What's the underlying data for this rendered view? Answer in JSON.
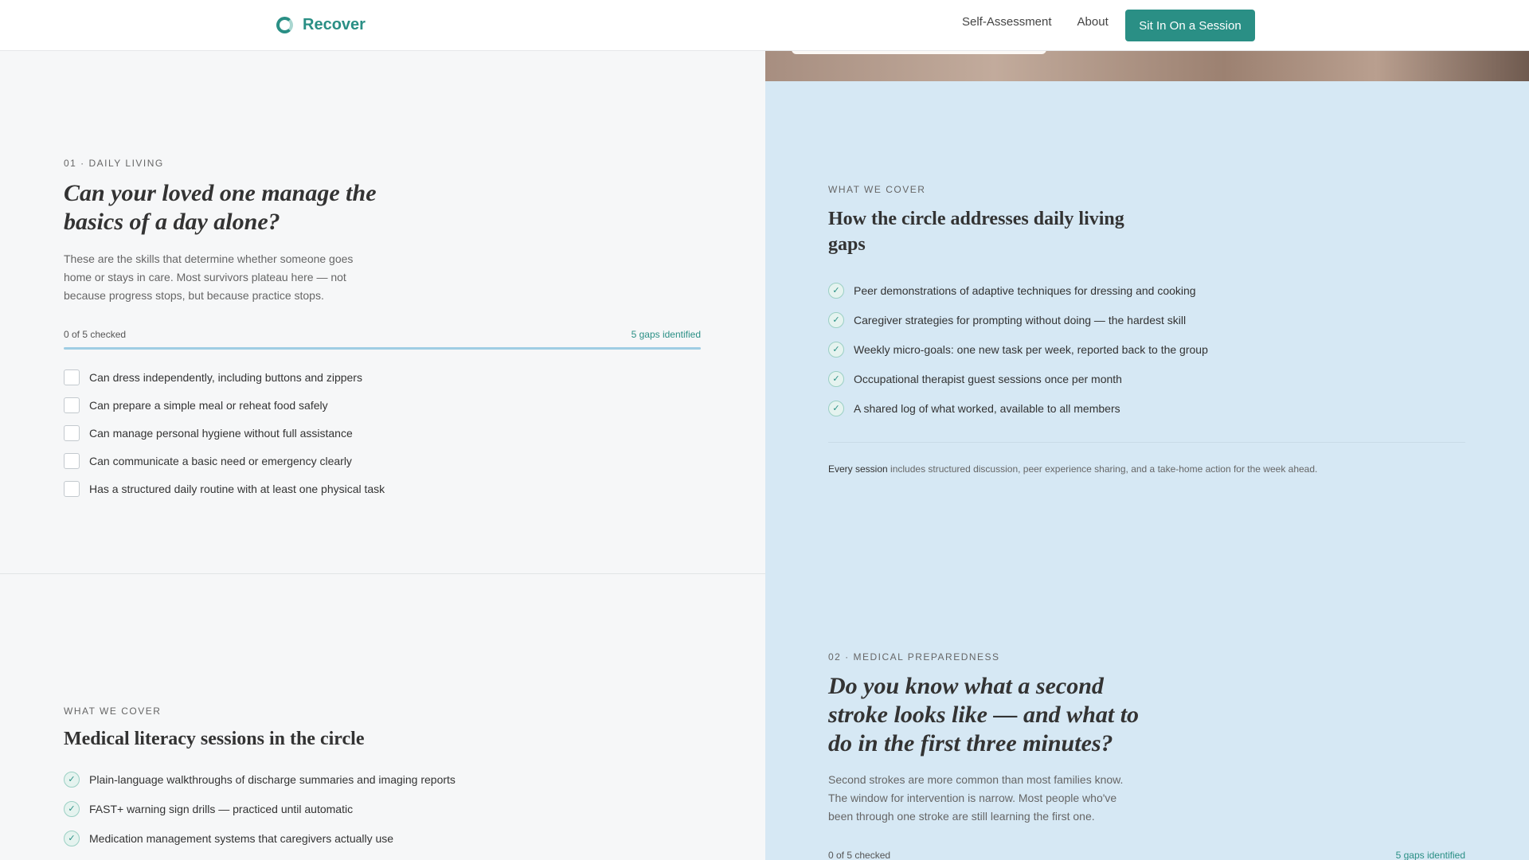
{
  "header": {
    "brand_name": "Recover",
    "nav": {
      "self_assessment": "Self-Assessment",
      "about": "About",
      "cta": "Sit In On a Session"
    }
  },
  "section1": {
    "eyebrow": "01 · DAILY LIVING",
    "title_line1": "Can your loved one manage the",
    "title_line2": "basics of a day alone?",
    "body_line1": "These are the skills that determine whether someone goes",
    "body_line2": "home or stays in care. Most survivors plateau here — not",
    "body_line3": "because progress stops, but because practice stops.",
    "checked_text": "0 of 5 checked",
    "gaps_text": "5 gaps identified",
    "checked_fraction": 0,
    "items": [
      {
        "label": "Can dress independently, including buttons and zippers",
        "checked": false
      },
      {
        "label": "Can prepare a simple meal or reheat food safely",
        "checked": false
      },
      {
        "label": "Can manage personal hygiene without full assistance",
        "checked": false
      },
      {
        "label": "Can communicate a basic need or emergency clearly",
        "checked": false
      },
      {
        "label": "Has a structured daily routine with at least one physical task",
        "checked": false
      }
    ]
  },
  "cover1": {
    "eyebrow": "WHAT WE COVER",
    "title_line1": "How the circle addresses daily living",
    "title_line2": "gaps",
    "items": [
      "Peer demonstrations of adaptive techniques for dressing and cooking",
      "Caregiver strategies for prompting without doing — the hardest skill",
      "Weekly micro-goals: one new task per week, reported back to the group",
      "Occupational therapist guest sessions once per month",
      "A shared log of what worked, available to all members"
    ],
    "footnote_strong": "Every session",
    "footnote_rest": " includes structured discussion, peer experience sharing, and a take-home action for the week ahead."
  },
  "cover2": {
    "eyebrow": "WHAT WE COVER",
    "title": "Medical literacy sessions in the circle",
    "items": [
      "Plain-language walkthroughs of discharge summaries and imaging reports",
      "FAST+ warning sign drills — practiced until automatic",
      "Medication management systems that caregivers actually use"
    ]
  },
  "section2": {
    "eyebrow": "02 · MEDICAL PREPAREDNESS",
    "title_line1": "Do you know what a second",
    "title_line2": "stroke looks like — and what to",
    "title_line3": "do in the first three minutes?",
    "body_line1": "Second strokes are more common than most families know.",
    "body_line2": "The window for intervention is narrow. Most people who've",
    "body_line3": "been through one stroke are still learning the first one.",
    "checked_text": "0 of 5 checked",
    "gaps_text": "5 gaps identified"
  },
  "icons": {
    "logo": "recover-logo-icon",
    "check": "check-icon"
  },
  "colors": {
    "accent": "#2a8f85",
    "right_panel": "#d6e8f4",
    "left_panel": "#f6f7f8"
  }
}
